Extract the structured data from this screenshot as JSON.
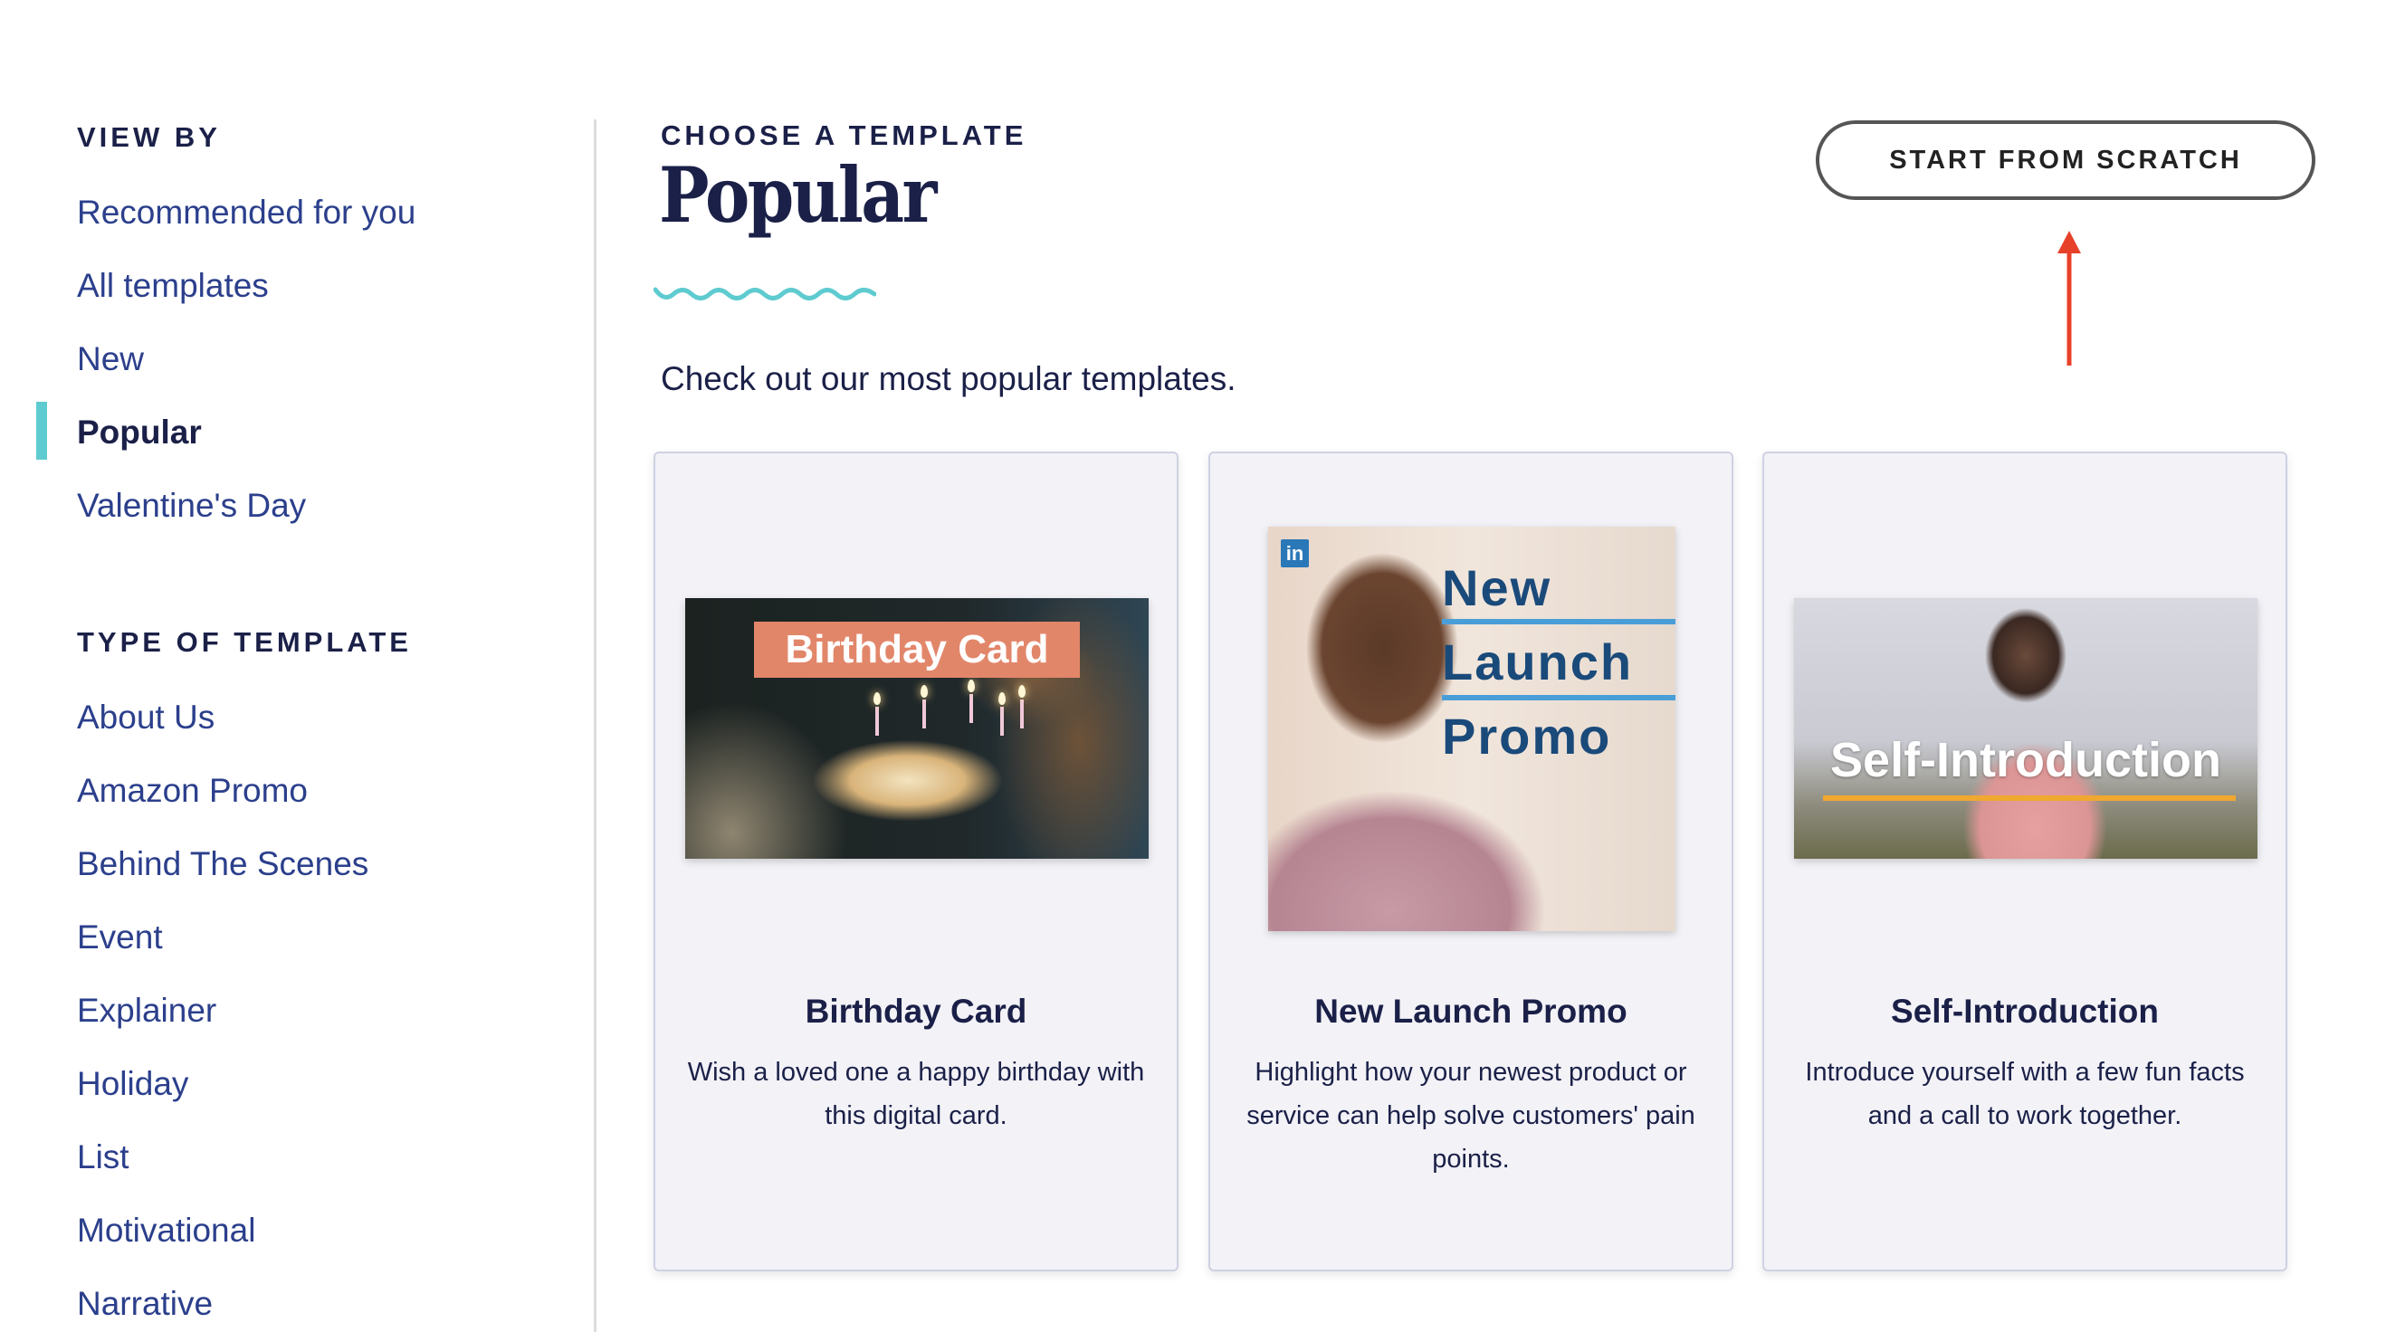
{
  "sidebar": {
    "view_by": {
      "heading": "VIEW BY",
      "items": [
        {
          "label": "Recommended for you",
          "active": false
        },
        {
          "label": "All templates",
          "active": false
        },
        {
          "label": "New",
          "active": false
        },
        {
          "label": "Popular",
          "active": true
        },
        {
          "label": "Valentine's Day",
          "active": false
        }
      ]
    },
    "type_of_template": {
      "heading": "TYPE OF TEMPLATE",
      "items": [
        {
          "label": "About Us"
        },
        {
          "label": "Amazon Promo"
        },
        {
          "label": "Behind The Scenes"
        },
        {
          "label": "Event"
        },
        {
          "label": "Explainer"
        },
        {
          "label": "Holiday"
        },
        {
          "label": "List"
        },
        {
          "label": "Motivational"
        },
        {
          "label": "Narrative"
        }
      ]
    }
  },
  "header": {
    "eyebrow": "CHOOSE A TEMPLATE",
    "title": "Popular",
    "subtitle": "Check out our most popular templates.",
    "start_button": "START FROM SCRATCH"
  },
  "cards": [
    {
      "title": "Birthday Card",
      "description": "Wish a loved one a happy birthday with this digital card.",
      "thumbnail": {
        "overlay_text": "Birthday Card"
      }
    },
    {
      "title": "New Launch Promo",
      "description": "Highlight how your newest product or service can help solve customers' pain points.",
      "thumbnail": {
        "badge": "in",
        "words": [
          "New",
          "Launch",
          "Promo"
        ]
      }
    },
    {
      "title": "Self-Introduction",
      "description": "Introduce yourself with a few fun facts and a call to work together.",
      "thumbnail": {
        "overlay_text": "Self-Introduction"
      }
    }
  ],
  "colors": {
    "accent_teal": "#5ecbd0",
    "navy": "#1b2048",
    "link_blue": "#2b3f8c",
    "annotation_red": "#e8412a",
    "card_bg": "#f2f2f7",
    "birthday_badge": "#e2866a",
    "promo_text": "#1a4a7a",
    "promo_rule": "#4a9ed8",
    "self_underline": "#f0a830"
  }
}
